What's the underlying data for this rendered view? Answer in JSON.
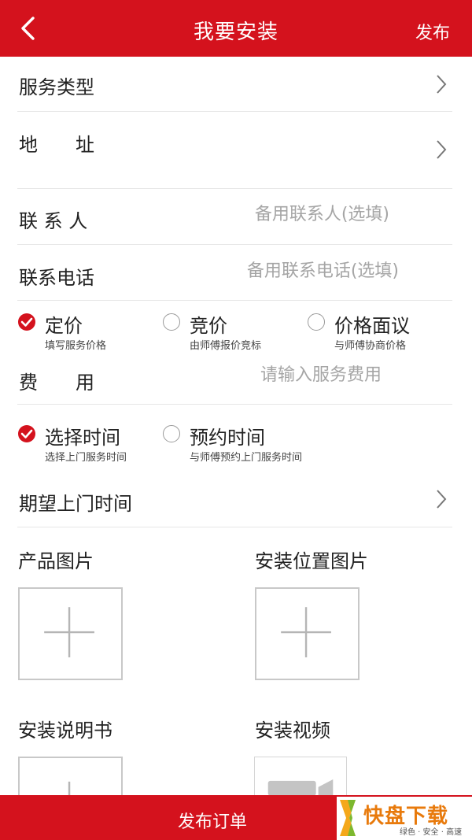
{
  "header": {
    "title": "我要安装",
    "publish_label": "发布"
  },
  "rows": {
    "service_type": "服务类型",
    "address": "地　　址",
    "contact": "联 系 人",
    "contact_placeholder": "备用联系人(选填)",
    "phone": "联系电话",
    "phone_placeholder": "备用联系电话(选填)",
    "fee": "费　　用",
    "fee_placeholder": "请输入服务费用",
    "expected_time": "期望上门时间"
  },
  "price_options": [
    {
      "label": "定价",
      "sub": "填写服务价格",
      "selected": true
    },
    {
      "label": "竞价",
      "sub": "由师傅报价竞标",
      "selected": false
    },
    {
      "label": "价格面议",
      "sub": "与师傅协商价格",
      "selected": false
    }
  ],
  "time_options": [
    {
      "label": "选择时间",
      "sub": "选择上门服务时间",
      "selected": true
    },
    {
      "label": "预约时间",
      "sub": "与师傅预约上门服务时间",
      "selected": false
    }
  ],
  "uploads": {
    "product_images": "产品图片",
    "install_position_images": "安装位置图片",
    "manual": "安装说明书",
    "video": "安装视频"
  },
  "bottom": {
    "submit_label": "发布订单"
  },
  "watermark": {
    "brand": "快盘下载",
    "tagline": "绿色 · 安全 · 高速"
  },
  "colors": {
    "accent": "#d4121d"
  }
}
